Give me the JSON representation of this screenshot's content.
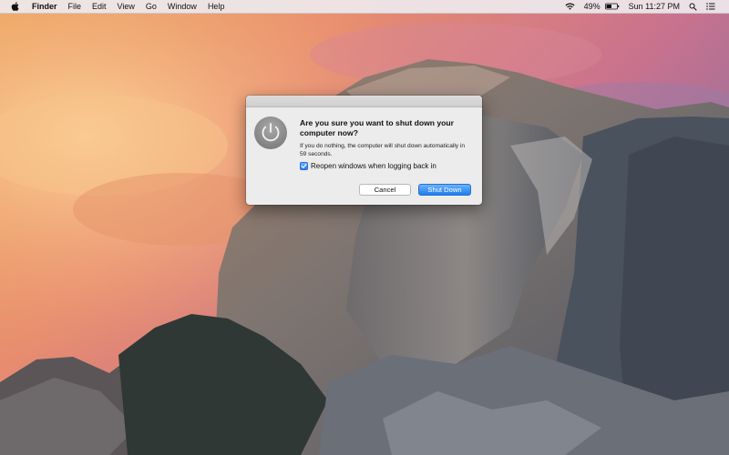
{
  "menubar": {
    "app_name": "Finder",
    "menus": [
      "File",
      "Edit",
      "View",
      "Go",
      "Window",
      "Help"
    ],
    "battery_percent": "49%",
    "clock": "Sun 11:27 PM"
  },
  "dialog": {
    "title": "Are you sure you want to shut down your computer now?",
    "message": "If you do nothing, the computer will shut down automatically in 59 seconds.",
    "checkbox_label": "Reopen windows when logging back in",
    "checkbox_checked": true,
    "cancel_label": "Cancel",
    "confirm_label": "Shut Down"
  },
  "colors": {
    "accent": "#2a7cf0"
  },
  "icons": [
    "apple-icon",
    "wifi-icon",
    "battery-icon",
    "spotlight-search-icon",
    "notification-center-icon",
    "power-icon",
    "checkmark-icon"
  ]
}
